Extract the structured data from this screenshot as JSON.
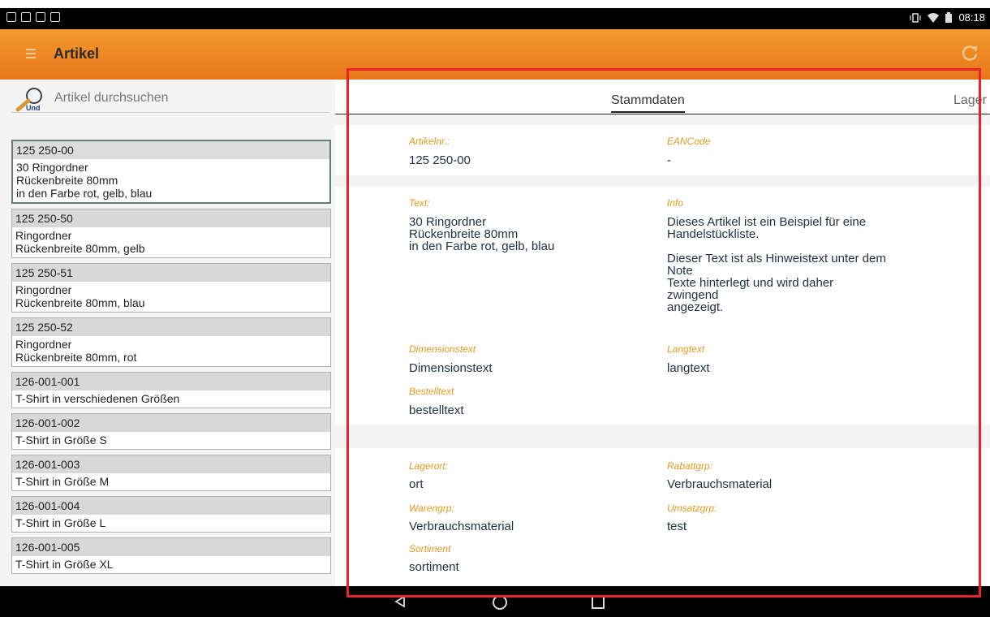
{
  "status": {
    "time": "08:18"
  },
  "toolbar": {
    "title": "Artikel"
  },
  "search": {
    "placeholder": "Artikel durchsuchen",
    "logo_text": "Und"
  },
  "articles": [
    {
      "number": "125 250-00",
      "desc": "30 Ringordner\nRückenbreite 80mm\nin den Farbe rot, gelb, blau"
    },
    {
      "number": "125 250-50",
      "desc": "Ringordner\nRückenbreite 80mm, gelb"
    },
    {
      "number": "125 250-51",
      "desc": "Ringordner\nRückenbreite 80mm, blau"
    },
    {
      "number": "125 250-52",
      "desc": "Ringordner\nRückenbreite 80mm, rot"
    },
    {
      "number": "126-001-001",
      "desc": "T-Shirt in verschiedenen Größen"
    },
    {
      "number": "126-001-002",
      "desc": "T-Shirt in Größe S"
    },
    {
      "number": "126-001-003",
      "desc": "T-Shirt in Größe M"
    },
    {
      "number": "126-001-004",
      "desc": "T-Shirt in Größe L"
    },
    {
      "number": "126-001-005",
      "desc": "T-Shirt in Größe XL"
    }
  ],
  "tabs": {
    "stammdaten": "Stammdaten",
    "lager": "Lager"
  },
  "details": {
    "artikelnr_label": "Artikelnr.:",
    "artikelnr": "125 250-00",
    "eancode_label": "EANCode",
    "eancode": "-",
    "text_label": "Text:",
    "text": "30 Ringordner\nRückenbreite 80mm\nin den Farbe rot, gelb, blau",
    "info_label": "Info",
    "info": "Dieses Artikel ist ein Beispiel für eine\nHandelstückliste.\n\nDieser Text ist als Hinweistext unter dem\nNote\nTexte hinterlegt und wird daher\nzwingend\nangezeigt.",
    "dimensionstext_label": "Dimensionstext",
    "dimensionstext": "Dimensionstext",
    "langtext_label": "Langtext",
    "langtext": "langtext",
    "bestelltext_label": "Bestelltext",
    "bestelltext": "bestelltext",
    "lagerort_label": "Lagerort:",
    "lagerort": "ort",
    "rabattgrp_label": "Rabattgrp:",
    "rabattgrp": "Verbrauchsmaterial",
    "warengrp_label": "Warengrp:",
    "warengrp": "Verbrauchsmaterial",
    "umsatzgrp_label": "Umsatzgrp:",
    "umsatzgrp": "test",
    "sortiment_label": "Sortiment",
    "sortiment": "sortiment"
  },
  "colors": {
    "toolbar": "#ee8a25",
    "label": "#e4991f",
    "highlight": "#e8232b"
  }
}
